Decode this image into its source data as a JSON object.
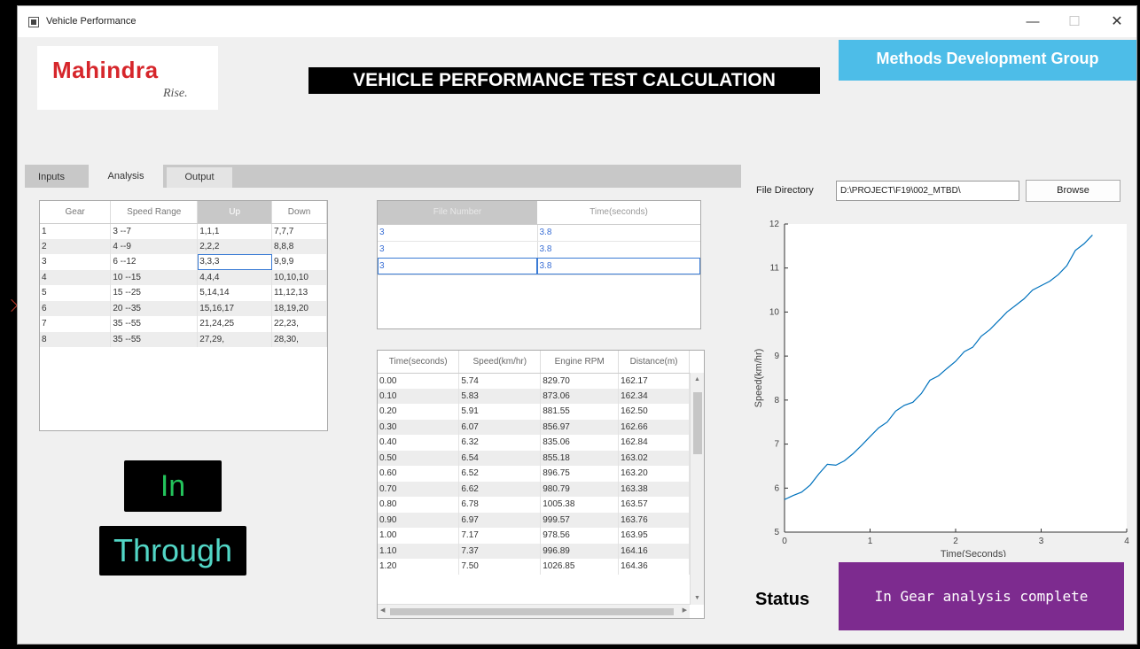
{
  "window": {
    "title": "Vehicle Performance",
    "minimize": "—",
    "maximize": "☐",
    "close": "✕"
  },
  "logo": {
    "name": "Mahindra",
    "tagline": "Rise."
  },
  "header": {
    "title": "VEHICLE PERFORMANCE TEST CALCULATION",
    "group": "Methods Development Group"
  },
  "tabs": [
    {
      "label": "Inputs"
    },
    {
      "label": "Analysis"
    },
    {
      "label": "Output"
    }
  ],
  "gear_table": {
    "columns": [
      "Gear",
      "Speed Range",
      "Up",
      "Down"
    ],
    "rows": [
      [
        "1",
        "3 --7",
        "1,1,1",
        "7,7,7"
      ],
      [
        "2",
        "4 --9",
        "2,2,2",
        "8,8,8"
      ],
      [
        "3",
        "6 --12",
        "3,3,3",
        "9,9,9"
      ],
      [
        "4",
        "10 --15",
        "4,4,4",
        "10,10,10"
      ],
      [
        "5",
        "15 --25",
        "5,14,14",
        "11,12,13"
      ],
      [
        "6",
        "20 --35",
        "15,16,17",
        "18,19,20"
      ],
      [
        "7",
        "35 --55",
        "21,24,25",
        "22,23,"
      ],
      [
        "8",
        "35 --55",
        "27,29,",
        "28,30,"
      ]
    ]
  },
  "file_table": {
    "columns": [
      "File Number",
      "Time(seconds)"
    ],
    "rows": [
      [
        "3",
        "3.8"
      ],
      [
        "3",
        "3.8"
      ],
      [
        "3",
        "3.8"
      ]
    ]
  },
  "data_table": {
    "columns": [
      "Time(seconds)",
      "Speed(km/hr)",
      "Engine RPM",
      "Distance(m)"
    ],
    "rows": [
      [
        "0.00",
        "5.74",
        "829.70",
        "162.17"
      ],
      [
        "0.10",
        "5.83",
        "873.06",
        "162.34"
      ],
      [
        "0.20",
        "5.91",
        "881.55",
        "162.50"
      ],
      [
        "0.30",
        "6.07",
        "856.97",
        "162.66"
      ],
      [
        "0.40",
        "6.32",
        "835.06",
        "162.84"
      ],
      [
        "0.50",
        "6.54",
        "855.18",
        "163.02"
      ],
      [
        "0.60",
        "6.52",
        "896.75",
        "163.20"
      ],
      [
        "0.70",
        "6.62",
        "980.79",
        "163.38"
      ],
      [
        "0.80",
        "6.78",
        "1005.38",
        "163.57"
      ],
      [
        "0.90",
        "6.97",
        "999.57",
        "163.76"
      ],
      [
        "1.00",
        "7.17",
        "978.56",
        "163.95"
      ],
      [
        "1.10",
        "7.37",
        "996.89",
        "164.16"
      ],
      [
        "1.20",
        "7.50",
        "1026.85",
        "164.36"
      ]
    ]
  },
  "status_badges": {
    "in": "In",
    "through": "Through"
  },
  "file_directory": {
    "label": "File Directory",
    "value": "D:\\PROJECT\\F19\\002_MTBD\\",
    "browse": "Browse"
  },
  "status": {
    "label": "Status",
    "message": "In Gear analysis complete"
  },
  "colors": {
    "line": "#0072bd",
    "status_bg": "#7d2b8f",
    "group_bg": "#4dbde8"
  },
  "chart_data": {
    "type": "line",
    "xlabel": "Time(Seconds)",
    "ylabel": "Speed(km/hr)",
    "xlim": [
      0,
      4
    ],
    "ylim": [
      5,
      12
    ],
    "xticks": [
      0,
      1,
      2,
      3,
      4
    ],
    "yticks": [
      5,
      6,
      7,
      8,
      9,
      10,
      11,
      12
    ],
    "grid": false,
    "series": [
      {
        "x": [
          0.0,
          0.1,
          0.2,
          0.3,
          0.4,
          0.5,
          0.6,
          0.7,
          0.8,
          0.9,
          1.0,
          1.1,
          1.2,
          1.3,
          1.4,
          1.5,
          1.6,
          1.7,
          1.8,
          1.9,
          2.0,
          2.1,
          2.2,
          2.3,
          2.4,
          2.5,
          2.6,
          2.7,
          2.8,
          2.9,
          3.0,
          3.1,
          3.2,
          3.3,
          3.4,
          3.5,
          3.6
        ],
        "y": [
          5.74,
          5.83,
          5.91,
          6.07,
          6.32,
          6.54,
          6.52,
          6.62,
          6.78,
          6.97,
          7.17,
          7.37,
          7.5,
          7.75,
          7.88,
          7.95,
          8.15,
          8.45,
          8.55,
          8.72,
          8.88,
          9.1,
          9.2,
          9.45,
          9.6,
          9.8,
          10.0,
          10.15,
          10.3,
          10.5,
          10.6,
          10.7,
          10.85,
          11.05,
          11.4,
          11.55,
          11.75
        ]
      }
    ]
  }
}
